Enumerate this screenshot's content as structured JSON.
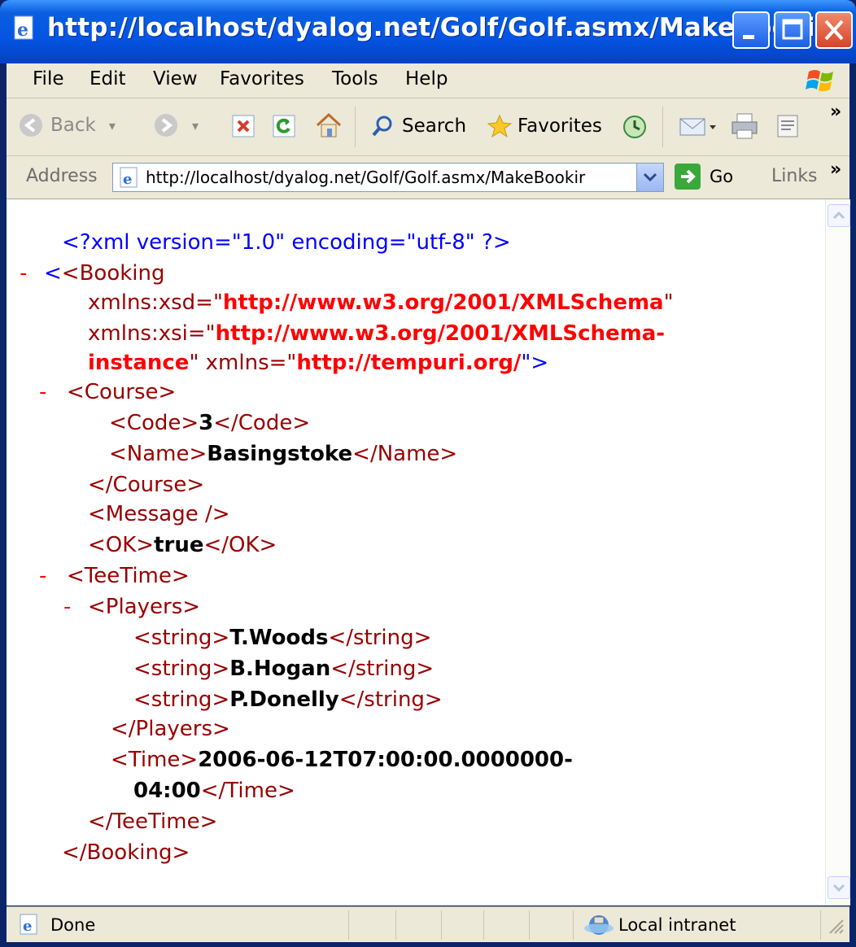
{
  "window": {
    "title": "http://localhost/dyalog.net/Golf/Golf.asmx/MakeBooking ..."
  },
  "menu": [
    "File",
    "Edit",
    "View",
    "Favorites",
    "Tools",
    "Help"
  ],
  "toolbar": {
    "back": "Back",
    "search": "Search",
    "favorites": "Favorites",
    "overflow": "»"
  },
  "address": {
    "label": "Address",
    "url": "http://localhost/dyalog.net/Golf/Golf.asmx/MakeBookir",
    "go": "Go",
    "links": "Links",
    "overflow": "»"
  },
  "xml": {
    "decl": "<?xml version=\"1.0\" encoding=\"utf-8\" ?>",
    "minus": "-",
    "booking_open": "<Booking",
    "attr_xsd_name": "xmlns:xsd=\"",
    "attr_xsd_val": "http://www.w3.org/2001/XMLSchema",
    "quote": "\"",
    "attr_xsi_name": "xmlns:xsi=\"",
    "attr_xsi_val1": "http://www.w3.org/2001/XMLSchema-",
    "attr_xsi_val2": "instance",
    "attr_xmlns_name": "\" xmlns=\"",
    "attr_xmlns_val": "http://tempuri.org/",
    "attr_end": "\">",
    "course_open": "<Course>",
    "code_open": "<Code>",
    "code_val": "3",
    "code_close": "</Code>",
    "name_open": "<Name>",
    "name_val": "Basingstoke",
    "name_close": "</Name>",
    "course_close": "</Course>",
    "message": "<Message />",
    "ok_open": "<OK>",
    "ok_val": "true",
    "ok_close": "</OK>",
    "teetime_open": "<TeeTime>",
    "players_open": "<Players>",
    "string_open": "<string>",
    "string_close": "</string>",
    "players": [
      "T.Woods",
      "B.Hogan",
      "P.Donelly"
    ],
    "players_close": "</Players>",
    "time_open": "<Time>",
    "time_val1": "2006-06-12T07:00:00.0000000-",
    "time_val2": "04:00",
    "time_close": "</Time>",
    "teetime_close": "</TeeTime>",
    "booking_close": "</Booking>"
  },
  "status": {
    "text": "Done",
    "zone": "Local intranet"
  },
  "colors": {
    "titlebar": "#0554e3",
    "chrome": "#ece9d8",
    "xml_markup": "#0000ff",
    "xml_tag": "#990000",
    "xml_attr_value": "#ff0000"
  }
}
